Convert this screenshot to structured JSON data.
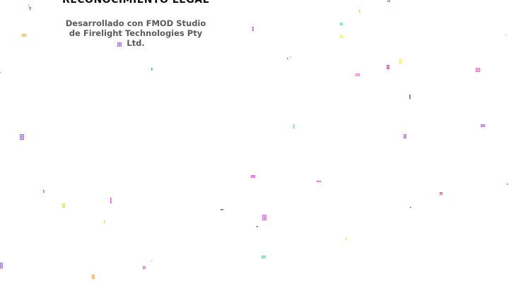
{
  "credits": {
    "heading": "RECONOCIMIENTO LEGAL",
    "body": "Desarrollado con FMOD Studio de Firelight Technologies Pty Ltd."
  },
  "confetti_colors": [
    "#e0a0f0",
    "#b000c0",
    "#7b3fc8",
    "#ff3fd0",
    "#ffe800",
    "#ff00e6",
    "#ff2aa8",
    "#00d8e8",
    "#29d95a",
    "#ff1493",
    "#8a2be2",
    "#d4d400",
    "#3a2a8a",
    "#0077cc",
    "#a0c020",
    "#cc0088",
    "#b8860b",
    "#cc33cc",
    "#1a1a6a",
    "#cc2255",
    "#ff8800",
    "#33bbbb",
    "#f0d000"
  ]
}
